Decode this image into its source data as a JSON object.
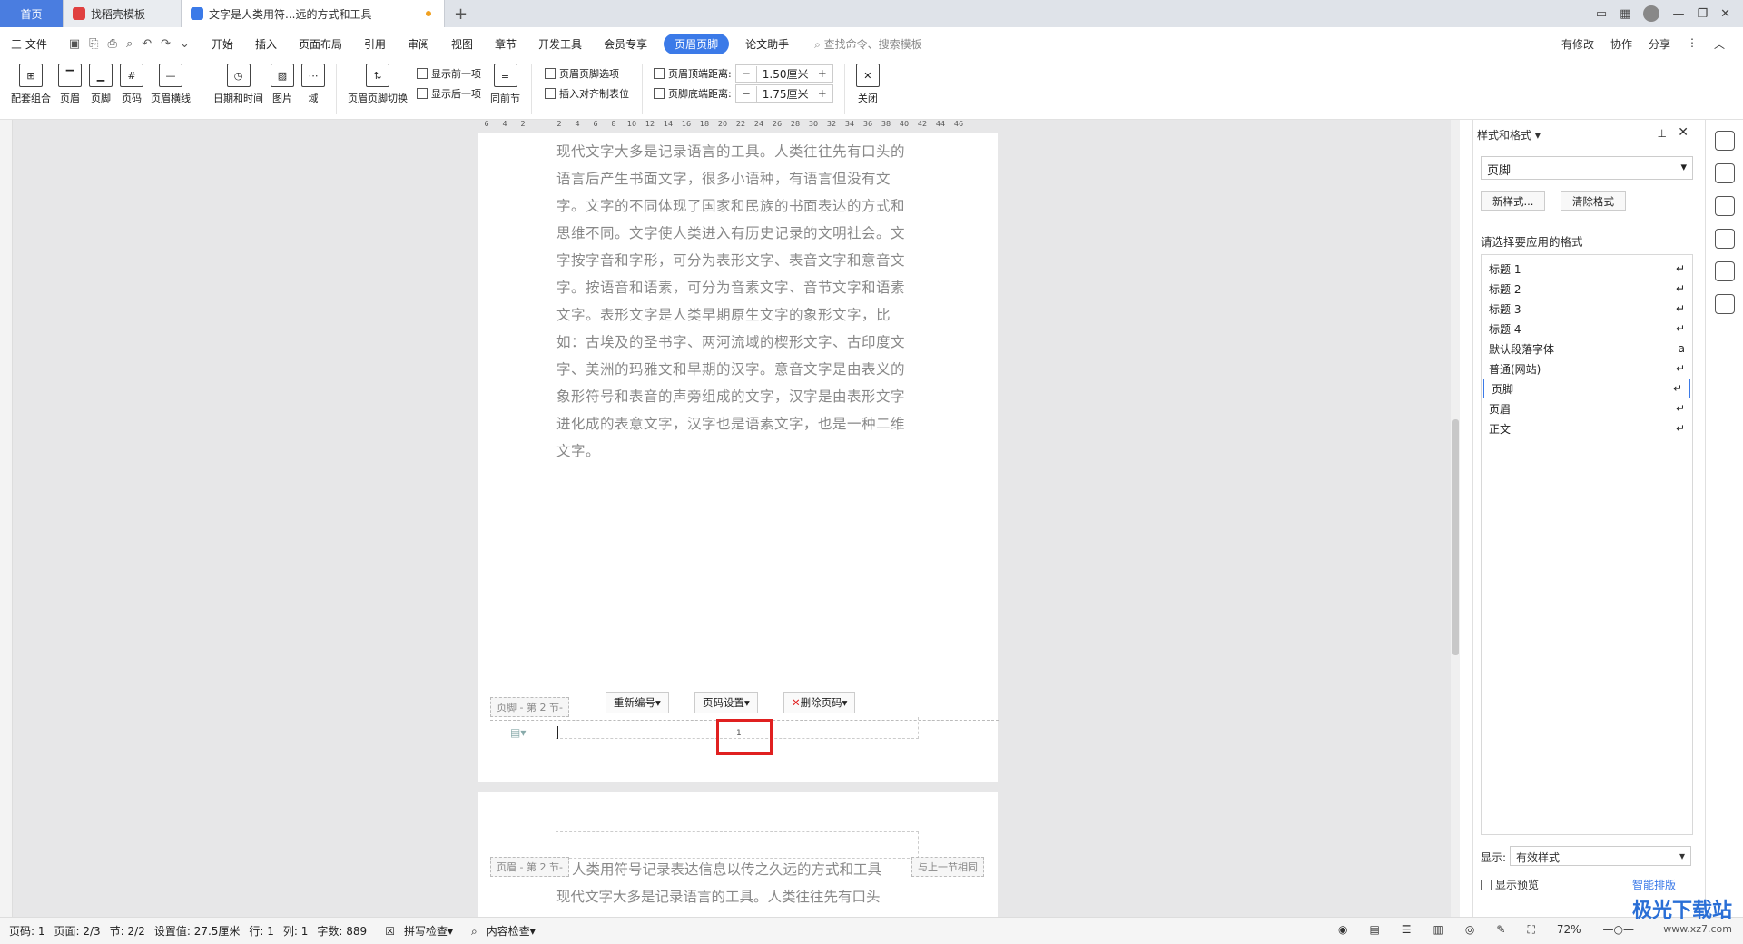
{
  "tabs": {
    "home": "首页",
    "template": "找稻壳模板",
    "doc": "文字是人类用符...远的方式和工具",
    "add": "+"
  },
  "menu": {
    "file": "三 文件",
    "items": [
      "开始",
      "插入",
      "页面布局",
      "引用",
      "审阅",
      "视图",
      "章节",
      "开发工具",
      "会员专享"
    ],
    "active": "页眉页脚",
    "after": "论文助手",
    "search": "查找命令、搜索模板",
    "right": [
      "有修改",
      "协作",
      "分享"
    ]
  },
  "ribbon": {
    "combo": "配套组合",
    "header": "页眉",
    "footer": "页脚",
    "pagenum": "页码",
    "headerline": "页眉横线",
    "datetime": "日期和时间",
    "picture": "图片",
    "field": "域",
    "switch": "页眉页脚切换",
    "prev": "显示前一项",
    "next": "显示后一项",
    "same": "同前节",
    "options": "页眉页脚选项",
    "tab": "插入对齐制表位",
    "topdist_label": "页眉顶端距离:",
    "topdist": "1.50厘米",
    "bottomdist_label": "页脚底端距离:",
    "bottomdist": "1.75厘米",
    "close": "关闭"
  },
  "ruler": [
    "6",
    "4",
    "2",
    "",
    "2",
    "4",
    "6",
    "8",
    "10",
    "12",
    "14",
    "16",
    "18",
    "20",
    "22",
    "24",
    "26",
    "28",
    "30",
    "32",
    "34",
    "36",
    "38",
    "40",
    "42",
    "44",
    "46"
  ],
  "doc": {
    "paragraph": "现代文字大多是记录语言的工具。人类往往先有口头的语言后产生书面文字，很多小语种，有语言但没有文字。文字的不同体现了国家和民族的书面表达的方式和思维不同。文字使人类进入有历史记录的文明社会。文字按字音和字形，可分为表形文字、表音文字和意音文字。按语音和语素，可分为音素文字、音节文字和语素文字。表形文字是人类早期原生文字的象形文字，比如：古埃及的圣书字、两河流域的楔形文字、古印度文字、美洲的玛雅文和早期的汉字。意音文字是由表义的象形符号和表音的声旁组成的文字，汉字是由表形文字进化成的表意文字，汉字也是语素文字，也是一种二维文字。",
    "footer_tag": "页脚 - 第 2 节-",
    "renumber": "重新编号",
    "pageset": "页码设置",
    "delpage": "删除页码",
    "pagenumber": "1",
    "header_tag": "页眉 - 第 2 节-",
    "header_text": "人类用符号记录表达信息以传之久远的方式和工具",
    "same_prev": "与上一节相同",
    "page2_line": "现代文字大多是记录语言的工具。人类往往先有口头"
  },
  "panel": {
    "title": "样式和格式",
    "current": "页脚",
    "new": "新样式...",
    "clear": "清除格式",
    "choose": "请选择要应用的格式",
    "styles": [
      "标题 1",
      "标题 2",
      "标题 3",
      "标题 4",
      "默认段落字体",
      "普通(网站)",
      "页脚",
      "页眉",
      "正文"
    ],
    "show_label": "显示:",
    "show_value": "有效样式",
    "preview": "显示预览",
    "smart": "智能排版"
  },
  "status": {
    "page": "页码: 1",
    "pages": "页面: 2/3",
    "section": "节: 2/2",
    "setting": "设置值: 27.5厘米",
    "row": "行: 1",
    "col": "列: 1",
    "words": "字数: 889",
    "spell": "拼写检查",
    "content": "内容检查",
    "zoom": "72%"
  },
  "watermark": {
    "name": "极光下载站",
    "url": "www.xz7.com"
  },
  "colors": {
    "accent": "#3b7ae8",
    "highlight": "#e02020"
  }
}
